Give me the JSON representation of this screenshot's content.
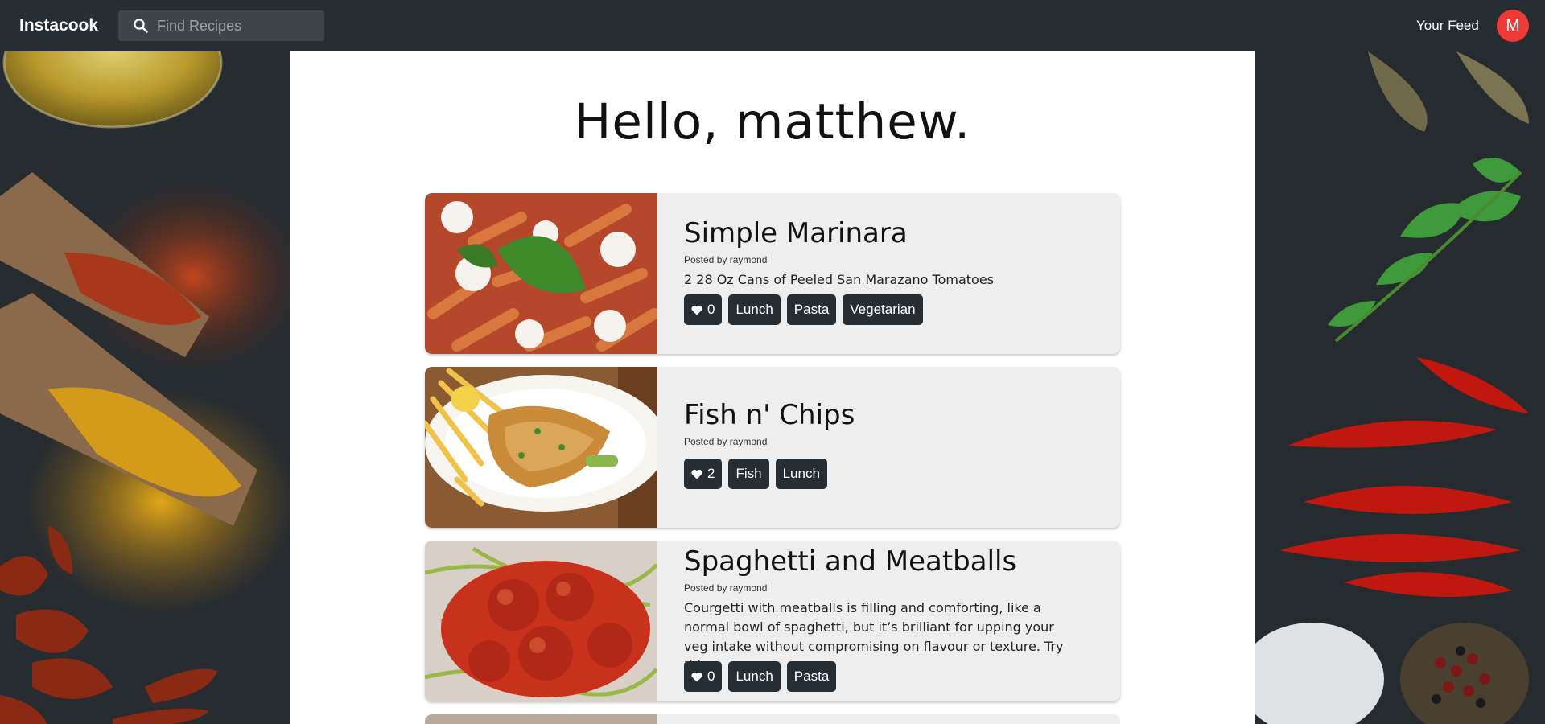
{
  "nav": {
    "brand": "Instacook",
    "search_placeholder": "Find Recipes",
    "feed_link": "Your Feed",
    "avatar_initial": "M",
    "avatar_color": "#ef3b36"
  },
  "greeting": "Hello, matthew.",
  "recipes": [
    {
      "title": "Simple Marinara",
      "author": "Posted by raymond",
      "description": "2 28 Oz Cans of Peeled San Marazano Tomatoes",
      "likes": "0",
      "tags": [
        "Lunch",
        "Pasta",
        "Vegetarian"
      ]
    },
    {
      "title": "Fish n' Chips",
      "author": "Posted by raymond",
      "description": "",
      "likes": "2",
      "tags": [
        "Fish",
        "Lunch"
      ]
    },
    {
      "title": "Spaghetti and Meatballs",
      "author": "Posted by raymond",
      "description": "Courgetti with meatballs is filling and comforting, like a normal bowl of spaghetti, but it’s brilliant for upping your veg intake without compromising on flavour or texture. Try this...",
      "likes": "0",
      "tags": [
        "Lunch",
        "Pasta"
      ]
    }
  ],
  "icons": {
    "search": "search-icon",
    "like": "heart-icon"
  }
}
